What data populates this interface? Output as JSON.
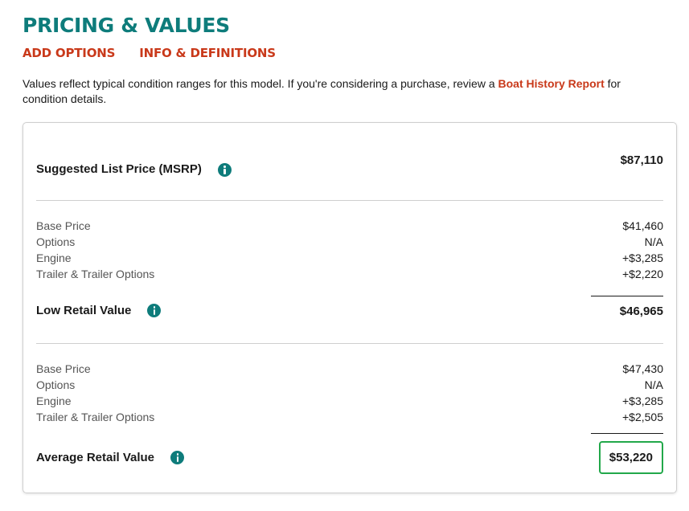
{
  "header": {
    "title": "PRICING & VALUES",
    "links": [
      "ADD OPTIONS",
      "INFO & DEFINITIONS"
    ]
  },
  "intro": {
    "text_before": "Values reflect typical condition ranges for this model. If you're considering a purchase, review a ",
    "link_text": "Boat History Report",
    "text_after": " for condition details."
  },
  "msrp": {
    "label": "Suggested List Price (MSRP)",
    "value": "$87,110"
  },
  "low_retail": {
    "items": [
      {
        "label": "Base Price",
        "value": "$41,460"
      },
      {
        "label": "Options",
        "value": "N/A"
      },
      {
        "label": "Engine",
        "value": "+$3,285"
      },
      {
        "label": "Trailer & Trailer Options",
        "value": "+$2,220"
      }
    ],
    "total_label": "Low Retail Value",
    "total_value": "$46,965"
  },
  "average_retail": {
    "items": [
      {
        "label": "Base Price",
        "value": "$47,430"
      },
      {
        "label": "Options",
        "value": "N/A"
      },
      {
        "label": "Engine",
        "value": "+$3,285"
      },
      {
        "label": "Trailer & Trailer Options",
        "value": "+$2,505"
      }
    ],
    "total_label": "Average Retail Value",
    "total_value": "$53,220"
  },
  "colors": {
    "teal": "#0e7c7b",
    "orange_red": "#c9391a",
    "highlight_green": "#22a84a"
  }
}
